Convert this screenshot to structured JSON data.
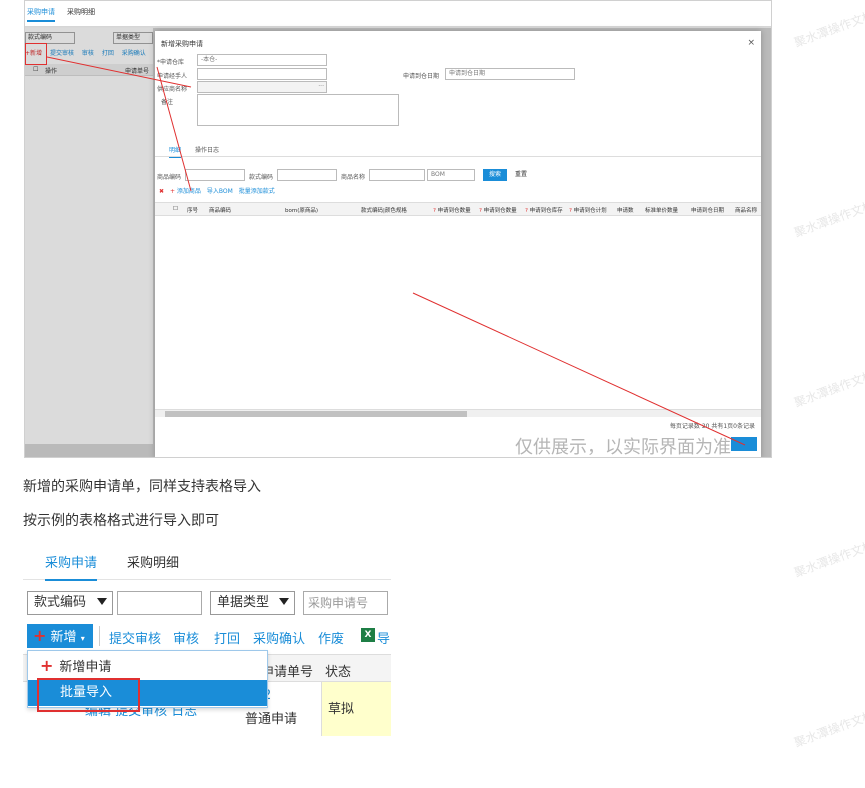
{
  "shot1": {
    "tabs": [
      "采购申请",
      "采购明细"
    ],
    "filter_left": "款式编码",
    "filter_type": "单据类型",
    "toolbar": [
      "+新增",
      "提交审核",
      "审核",
      "打回",
      "采购确认"
    ],
    "list_header": [
      "操作",
      "申请单号"
    ],
    "dialog": {
      "title": "新增采购申请",
      "close": "×",
      "labels": {
        "warehouse": "*申请仓库",
        "handler": "申请经手人",
        "supplier": "供应商名称",
        "note": "备注",
        "expected_date": "申请到仓日期"
      },
      "warehouse_value": "-本仓-",
      "date_placeholder": "申请到仓日期",
      "supplier_ellipsis": "···",
      "tabs": [
        "明细",
        "操作日志"
      ],
      "filters": {
        "product_code_label": "商品编码",
        "style_code_label": "款式编码",
        "product_name_label": "商品名称",
        "bom_placeholder": "BOM",
        "query": "搜索",
        "reset": "重置"
      },
      "actions": [
        "添加商品",
        "导入BOM",
        "批量添加款式"
      ],
      "grid_columns": [
        "序号",
        "商品编码",
        "bom(原商品)",
        "款式编码|颜色规格",
        "申请到仓数量",
        "申请到仓数量",
        "申请到仓库存",
        "申请到仓计划",
        "申请数",
        "标准单价数量",
        "申请到仓日期",
        "商品名称"
      ],
      "pager": "每页记录数 20  共有1页0条记录",
      "watermark": "仅供展示，以实际界面为准"
    }
  },
  "text1": "新增的采购申请单，同样支持表格导入",
  "text2": "按示例的表格格式进行导入即可",
  "shot2": {
    "tabs": [
      "采购申请",
      "采购明细"
    ],
    "filter_style": "款式编码",
    "filter_type": "单据类型",
    "search_placeholder": "采购申请号",
    "add_button": "新增",
    "toolbar": [
      "提交审核",
      "审核",
      "打回",
      "采购确认",
      "作废",
      "导"
    ],
    "excel_letter": "X",
    "table_header": {
      "order_no": "申请单号",
      "status": "状态"
    },
    "row": {
      "ops": "编辑  提交审核  日志",
      "order_no": "2",
      "order_type": "普通申请",
      "status": "草拟"
    },
    "menu": [
      "新增申请",
      "批量导入"
    ]
  },
  "bg_watermark": "聚水潭操作文档"
}
